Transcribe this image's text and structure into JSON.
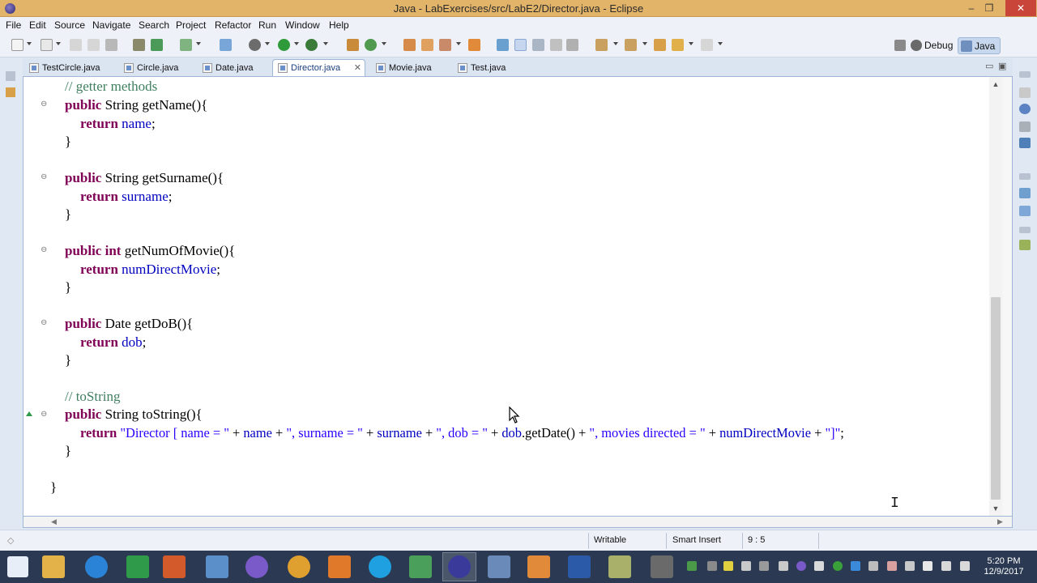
{
  "window": {
    "title": "Java - LabExercises/src/LabE2/Director.java - Eclipse",
    "min_symbol": "–",
    "max_symbol": "❐",
    "close_symbol": "✕"
  },
  "menu": [
    "File",
    "Edit",
    "Source",
    "Navigate",
    "Search",
    "Project",
    "Refactor",
    "Run",
    "Window",
    "Help"
  ],
  "perspectives": {
    "debug": "Debug",
    "java": "Java",
    "open_icon": "open-perspective-icon"
  },
  "tabs": [
    {
      "label": "TestCircle.java"
    },
    {
      "label": "Circle.java"
    },
    {
      "label": "Date.java"
    },
    {
      "label": "Director.java",
      "active": true,
      "close": "✕"
    },
    {
      "label": "Movie.java"
    },
    {
      "label": "Test.java"
    }
  ],
  "tab_controls": {
    "minimize": "▭",
    "maximize": "▣"
  },
  "code": {
    "comment_getters": "// getter methods",
    "kw_public": "public",
    "kw_return": "return",
    "kw_int": "int",
    "t_string": "String",
    "t_date": "Date",
    "m_getName": "getName(){",
    "f_name": "name",
    "m_getSurname": "getSurname(){",
    "f_surname": "surname",
    "m_getNum": "getNumOfMovie(){",
    "f_numDirectMovie": "numDirectMovie",
    "m_getDoB": "getDoB(){",
    "f_dob": "dob",
    "semi": ";",
    "close_brace": "}",
    "comment_tostring": "// toString",
    "m_toString": "toString(){",
    "s1": "\"Director [ name = \"",
    "plus": " + ",
    "s2": "\", surname = \"",
    "s3": "\", dob = \"",
    "call_getdate": ".getDate()",
    "s4": "\", movies directed = \"",
    "s5": "\"]\"",
    "fold_symbol": "⊖"
  },
  "scroll": {
    "up": "▲",
    "down": "▼",
    "left": "◀",
    "right": "▶"
  },
  "status": {
    "writable": "Writable",
    "insert_mode": "Smart Insert",
    "position": "9 : 5"
  },
  "taskbar": {
    "time": "5:20 PM",
    "date": "12/9/2017"
  },
  "colors": {
    "keyword": "#7f0055",
    "field": "#0000c0",
    "string": "#2a00ff",
    "comment": "#3f7f5f",
    "title_bar": "#e2b46a"
  }
}
